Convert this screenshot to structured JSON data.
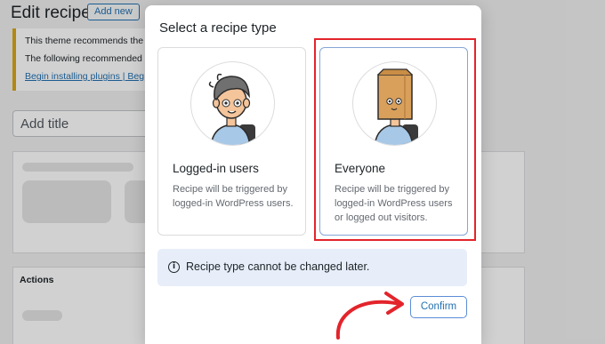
{
  "background": {
    "page_title": "Edit recipe",
    "add_new_label": "Add new",
    "notice_line1": "This theme recommends the",
    "notice_line2": "The following recommended",
    "notice_links": "Begin installing plugins | Beg",
    "title_placeholder": "Add title",
    "actions_label": "Actions"
  },
  "modal": {
    "title": "Select a recipe type",
    "options": [
      {
        "title": "Logged-in users",
        "description": "Recipe will be triggered by logged-in WordPress users.",
        "avatar_icon": "user-avatar-icon"
      },
      {
        "title": "Everyone",
        "description": "Recipe will be triggered by logged-in WordPress users or logged out visitors.",
        "avatar_icon": "paper-bag-avatar-icon"
      }
    ],
    "info_text": "Recipe type cannot be changed later.",
    "confirm_label": "Confirm"
  },
  "colors": {
    "accent": "#2271b1",
    "highlight": "#e3242b",
    "info_bg": "#e7eef9"
  }
}
